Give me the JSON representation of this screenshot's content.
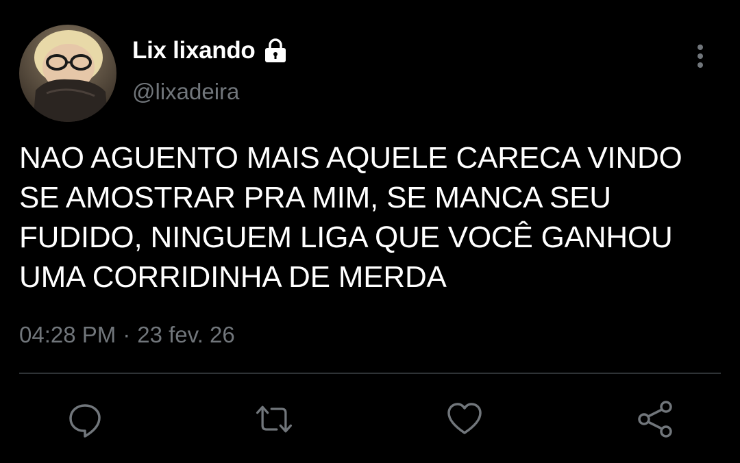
{
  "user": {
    "display_name": "Lix lixando",
    "handle": "@lixadeira",
    "verified_lock": true
  },
  "tweet": {
    "text": "NAO AGUENTO MAIS AQUELE CARECA VINDO SE AMOSTRAR PRA MIM, SE MANCA SEU FUDIDO, NINGUEM LIGA QUE VOCÊ GANHOU UMA CORRIDINHA DE MERDA",
    "time": "04:28 PM",
    "separator": "·",
    "date": "23 fev. 26"
  },
  "actions": {
    "reply_icon": "reply-icon",
    "retweet_icon": "retweet-icon",
    "like_icon": "heart-icon",
    "share_icon": "share-icon"
  },
  "colors": {
    "background": "#000000",
    "primary_text": "#ffffff",
    "secondary_text": "#71767b",
    "divider": "#2f3336"
  }
}
